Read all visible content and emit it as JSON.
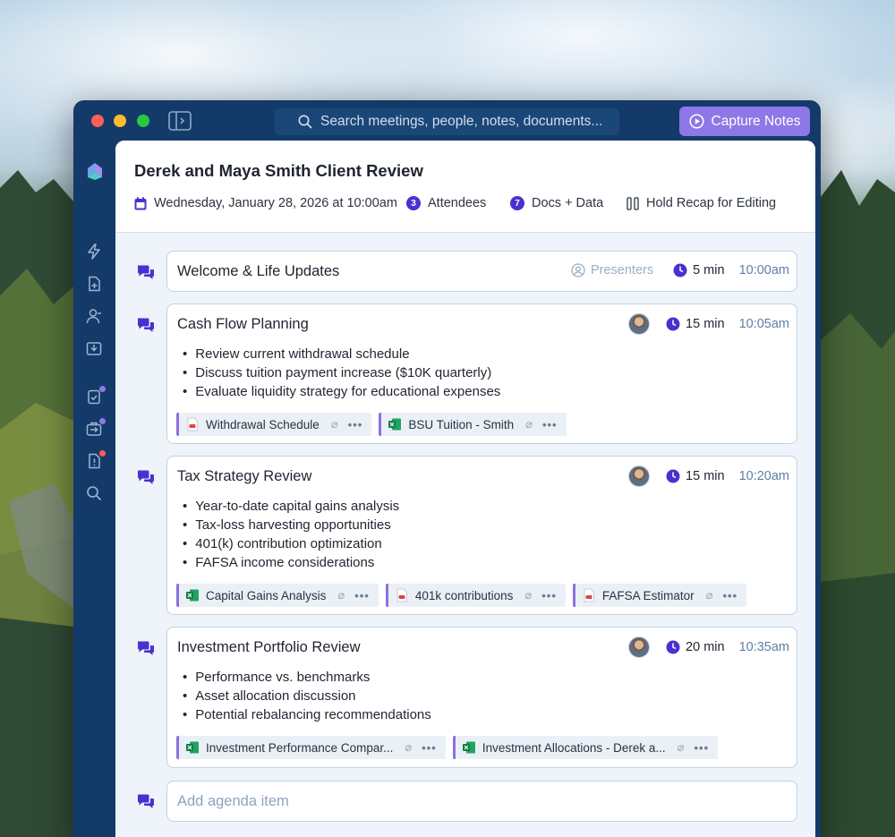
{
  "colors": {
    "window_bg": "#143a6a",
    "accent": "#8e77e6",
    "badge": "#4b2fd1",
    "attachment_bar": "#8a72e0"
  },
  "titlebar": {
    "search_placeholder": "Search meetings, people, notes, documents...",
    "capture_label": "Capture Notes",
    "icons": [
      "sidebar-toggle-icon",
      "search-icon",
      "play-circle-icon"
    ]
  },
  "rail": {
    "icons": [
      "logo-icon",
      "lightning-icon",
      "document-plus-icon",
      "people-icon",
      "inbox-download-icon",
      "clipboard-check-icon",
      "briefcase-export-icon",
      "document-alert-icon",
      "search-icon"
    ]
  },
  "meeting": {
    "title": "Derek and Maya Smith Client Review",
    "date": "Wednesday, January 28, 2026 at 10:00am",
    "attendees_count": "3",
    "attendees_label": "Attendees",
    "docs_count": "7",
    "docs_label": "Docs + Data",
    "hold_label": "Hold Recap for Editing"
  },
  "agenda": [
    {
      "title": "Welcome & Life Updates",
      "presenters_label": "Presenters",
      "duration": "5 min",
      "time": "10:00am"
    },
    {
      "title": "Cash Flow Planning",
      "duration": "15 min",
      "time": "10:05am",
      "bullets": [
        "Review current withdrawal schedule",
        "Discuss tuition payment increase ($10K quarterly)",
        "Evaluate liquidity strategy for educational expenses"
      ],
      "attachments": [
        {
          "type": "pdf",
          "name": "Withdrawal Schedule"
        },
        {
          "type": "excel",
          "name": "BSU Tuition - Smith"
        }
      ]
    },
    {
      "title": "Tax Strategy Review",
      "duration": "15 min",
      "time": "10:20am",
      "bullets": [
        "Year-to-date capital gains analysis",
        "Tax-loss harvesting opportunities",
        "401(k) contribution optimization",
        "FAFSA income considerations"
      ],
      "attachments": [
        {
          "type": "excel",
          "name": "Capital Gains Analysis"
        },
        {
          "type": "pdf",
          "name": "401k contributions"
        },
        {
          "type": "pdf",
          "name": "FAFSA Estimator"
        }
      ]
    },
    {
      "title": "Investment Portfolio Review",
      "duration": "20 min",
      "time": "10:35am",
      "bullets": [
        "Performance vs. benchmarks",
        "Asset allocation discussion",
        "Potential rebalancing recommendations"
      ],
      "attachments": [
        {
          "type": "excel",
          "name": "Investment Performance Compar..."
        },
        {
          "type": "excel",
          "name": "Investment Allocations - Derek a..."
        }
      ]
    }
  ],
  "add_item_placeholder": "Add agenda item"
}
